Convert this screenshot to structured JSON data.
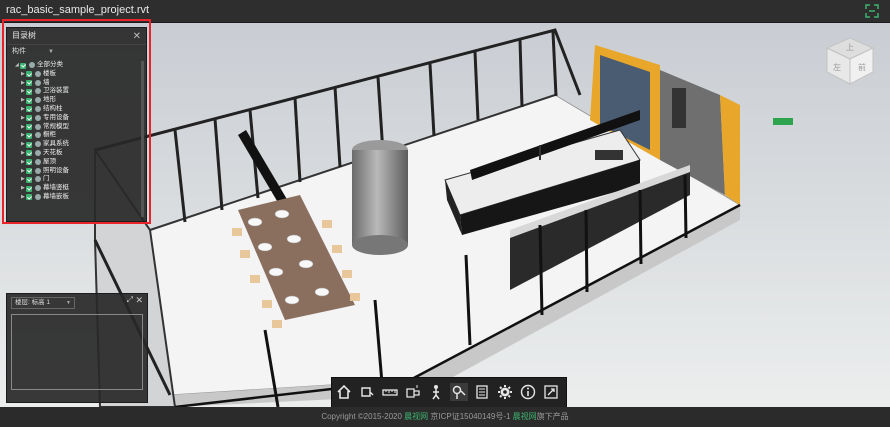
{
  "window": {
    "title": "rac_basic_sample_project.rvt"
  },
  "tree_panel": {
    "title": "目录树",
    "filter_label": "构件",
    "root_label": "全部分类",
    "items": [
      "楼板",
      "墙",
      "卫浴装置",
      "地形",
      "结构柱",
      "专用设备",
      "常规模型",
      "橱柜",
      "家具系统",
      "天花板",
      "屋顶",
      "照明设备",
      "门",
      "幕墙竖梃",
      "幕墙嵌板"
    ]
  },
  "minimap": {
    "floor_label": "楼层: 标高 1"
  },
  "toolbar": {
    "icons": [
      "home-icon",
      "section-box-icon",
      "measure-icon",
      "explode-icon",
      "walk-icon",
      "roam-icon",
      "properties-icon",
      "settings-icon",
      "info-icon",
      "fullscreen-icon"
    ]
  },
  "footer": {
    "copyright": "Copyright ©2015-2020",
    "brand1": "晨视网",
    "icp": " 京ICP证15040149号-1 ",
    "brand2": "晨视网",
    "suffix": "旗下产品"
  },
  "viewcube": {
    "top": "上",
    "front": "前",
    "left": "左"
  },
  "colors": {
    "accent": "#3cb371",
    "highlight_border": "#e8242a",
    "toolbar_bg": "#222222"
  }
}
